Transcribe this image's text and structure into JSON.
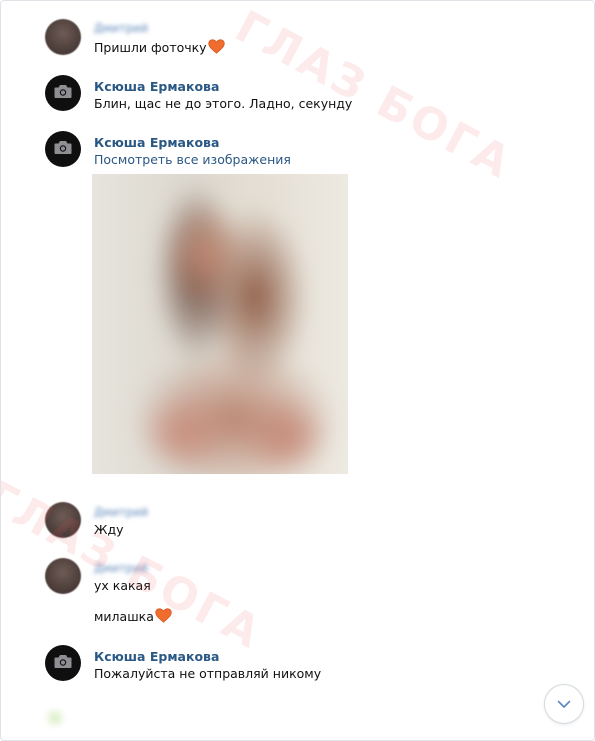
{
  "watermark": {
    "text_top": "ГЛАЗ БОГА",
    "text_bottom": "ГЛАЗ БОГА"
  },
  "messages": [
    {
      "author": "Дмитрий",
      "text": "Пришли фоточку",
      "emoji": "heart"
    },
    {
      "author": "Ксюша Ермакова",
      "text": "Блин, щас не до этого. Ладно, секунду"
    },
    {
      "author": "Ксюша Ермакова",
      "link": "Посмотреть все изображения"
    },
    {
      "author": "Дмитрий",
      "text": "Жду"
    },
    {
      "author": "Дмитрий",
      "text": "ух какая",
      "text2": "милашка",
      "emoji": "heart"
    },
    {
      "author": "Ксюша Ермакова",
      "text": "Пожалуйста не отправляй никому"
    }
  ],
  "colors": {
    "name": "#2a5885",
    "heart": "#f06d2e",
    "watermark": "#f0505a"
  },
  "icons": {
    "avatar_placeholder": "camera-icon",
    "scroll_down": "chevron-down-icon",
    "emoji": "heart-icon"
  }
}
